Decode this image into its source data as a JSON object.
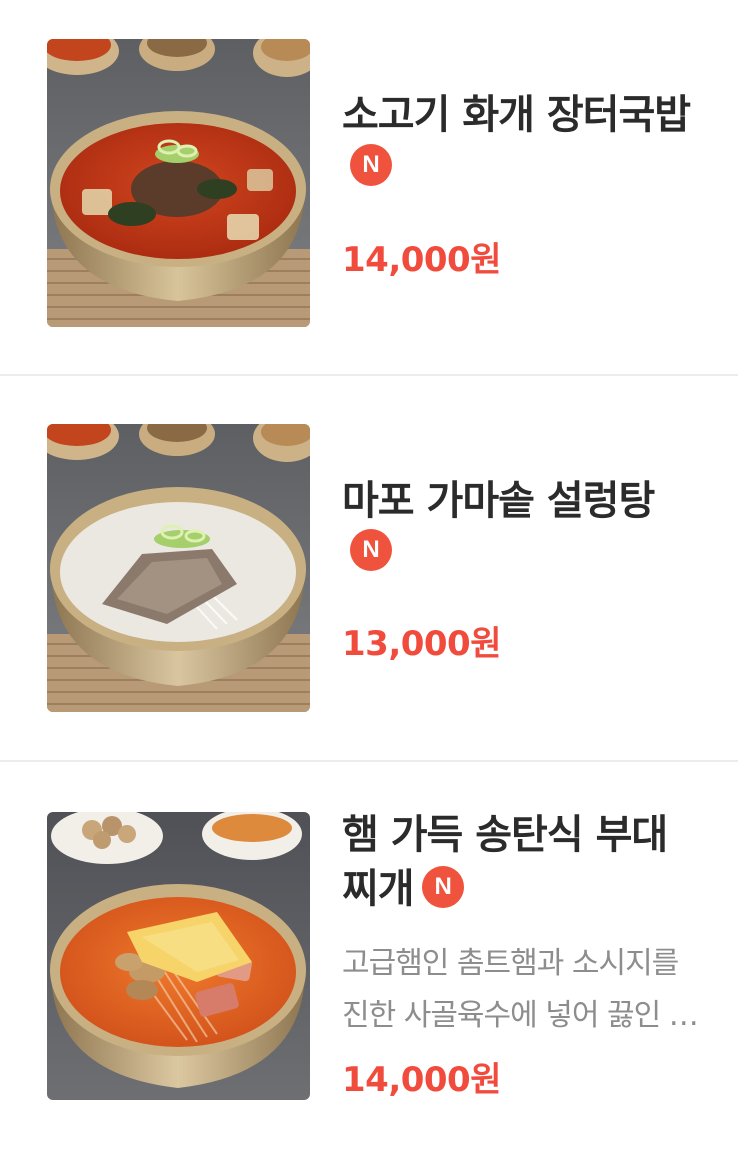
{
  "menu": {
    "items": [
      {
        "name": "소고기 화개 장터국밥",
        "badge": "N",
        "price": "14,000원",
        "soup_color": "#c8381a"
      },
      {
        "name": "마포 가마솥 설렁탕",
        "badge": "N",
        "price": "13,000원",
        "soup_color": "#e6e3de"
      },
      {
        "name_line1": "햄 가득 송탄식 부대",
        "name_line2": "찌개",
        "badge": "N",
        "description": "고급햄인 촘트햄과 소시지를 진한 사골육수에 넣어 끓인 부대찌개",
        "price": "14,000원",
        "soup_color": "#e2641e"
      }
    ]
  },
  "colors": {
    "accent": "#f04b3c",
    "badge": "#f0533d",
    "brass": "#b99c6f",
    "divider": "#ececec"
  }
}
